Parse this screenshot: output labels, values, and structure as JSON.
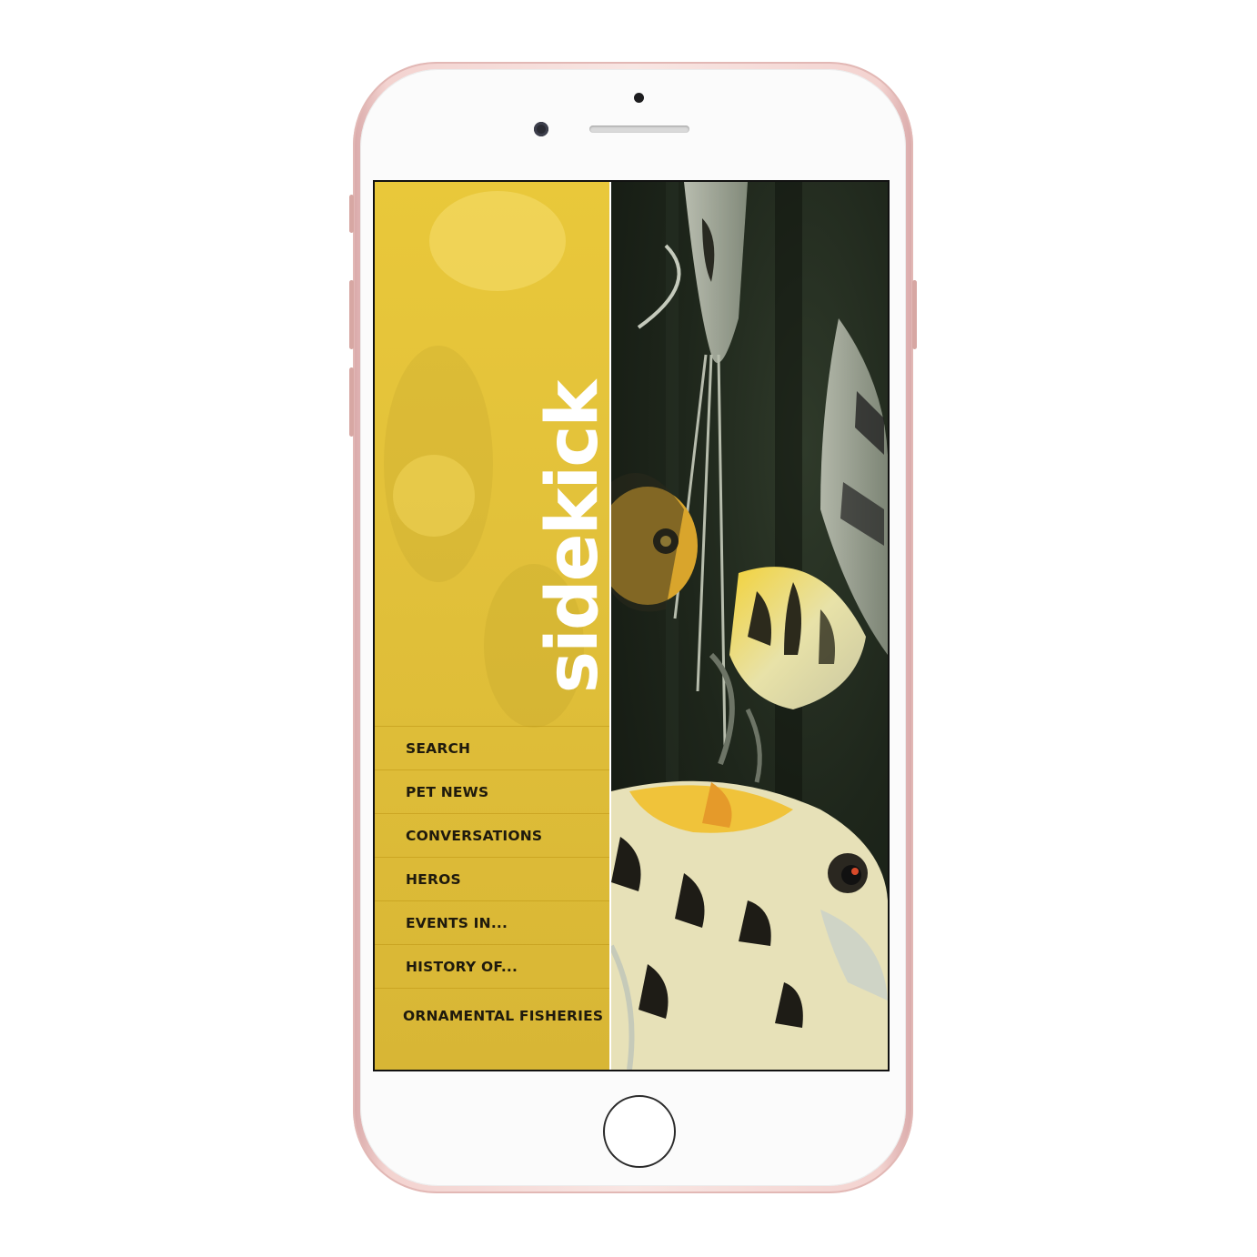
{
  "app": {
    "brand": "sidekick"
  },
  "menu": {
    "items": [
      {
        "id": "search",
        "label": "SEARCH"
      },
      {
        "id": "pet-news",
        "label": "PET NEWS"
      },
      {
        "id": "conversations",
        "label": "CONVERSATIONS"
      },
      {
        "id": "heros",
        "label": "HEROS"
      },
      {
        "id": "events",
        "label": "EVENTS IN..."
      },
      {
        "id": "history",
        "label": "HISTORY OF..."
      },
      {
        "id": "ornamental-fisheries",
        "label": "ORNAMENTAL FISHERIES"
      }
    ]
  },
  "colors": {
    "panel": "#e2c13a",
    "text": "#1f1a0d",
    "phone": "#f3d3d0"
  }
}
